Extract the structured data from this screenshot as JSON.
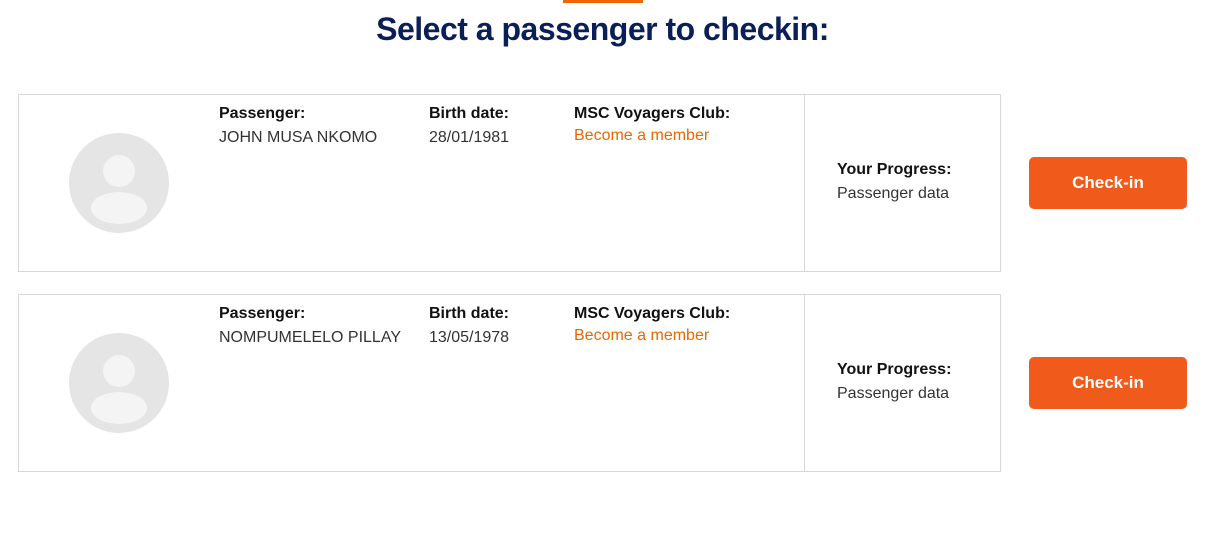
{
  "page_title": "Select a passenger to checkin:",
  "labels": {
    "passenger": "Passenger:",
    "birth_date": "Birth date:",
    "voyagers_club": "MSC Voyagers Club:",
    "progress": "Your Progress:",
    "become_member": "Become a member",
    "checkin_button": "Check-in"
  },
  "passengers": [
    {
      "name": "JOHN MUSA NKOMO",
      "birth_date": "28/01/1981",
      "progress": "Passenger data"
    },
    {
      "name": "NOMPUMELELO PILLAY",
      "birth_date": "13/05/1978",
      "progress": "Passenger data"
    }
  ]
}
